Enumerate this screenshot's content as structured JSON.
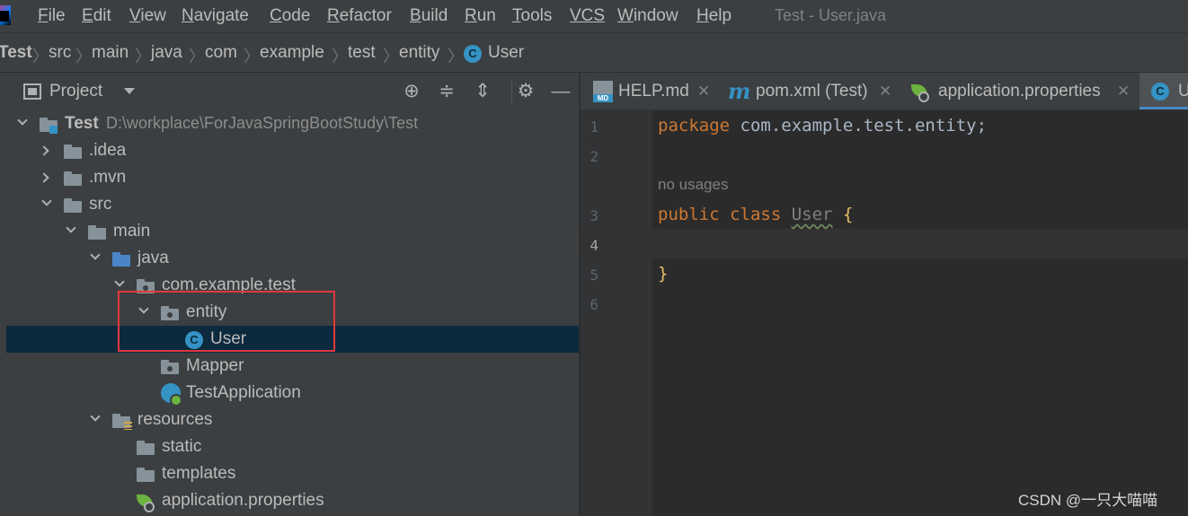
{
  "window": {
    "title": "Test - User.java"
  },
  "menu": {
    "items": [
      {
        "mnemonic": "F",
        "rest": "ile"
      },
      {
        "mnemonic": "E",
        "rest": "dit"
      },
      {
        "mnemonic": "V",
        "rest": "iew"
      },
      {
        "mnemonic": "N",
        "rest": "avigate"
      },
      {
        "mnemonic": "C",
        "rest": "ode"
      },
      {
        "mnemonic": "R",
        "rest": "efactor"
      },
      {
        "mnemonic": "B",
        "rest": "uild"
      },
      {
        "mnemonic": "R",
        "rest": "un"
      },
      {
        "mnemonic": "T",
        "rest": "ools"
      },
      {
        "mnemonic": "VCS",
        "rest": ""
      },
      {
        "mnemonic": "W",
        "rest": "indow"
      },
      {
        "mnemonic": "H",
        "rest": "elp"
      }
    ]
  },
  "breadcrumbs": [
    "Test",
    "src",
    "main",
    "java",
    "com",
    "example",
    "test",
    "entity",
    "User"
  ],
  "project_panel": {
    "title": "Project",
    "tree": {
      "root_label": "Test",
      "root_path": "D:\\workplace\\ForJavaSpringBootStudy\\Test",
      "idea": ".idea",
      "mvn": ".mvn",
      "src": "src",
      "main": "main",
      "java": "java",
      "package": "com.example.test",
      "entity": "entity",
      "user": "User",
      "mapper": "Mapper",
      "test_app": "TestApplication",
      "resources": "resources",
      "static": "static",
      "templates": "templates",
      "app_props": "application.properties"
    }
  },
  "editor": {
    "tabs": [
      "HELP.md",
      "pom.xml (Test)",
      "application.properties",
      "User"
    ],
    "active_tab": "User",
    "line_numbers": [
      "1",
      "2",
      "3",
      "4",
      "5",
      "6"
    ],
    "code": {
      "line1_kw": "package",
      "line1_rest": " com.example.test.entity;",
      "usage_hint": "no usages",
      "line3_kw": "public class",
      "line3_name": "User",
      "line3_brace": "{",
      "line5_brace": "}"
    },
    "current_line": "4"
  },
  "watermark": "CSDN @一只大喵喵",
  "colors": {
    "accent": "#4a88c7",
    "selection": "#0d293e",
    "highlight_box": "#e0393c",
    "keyword": "#cc7832"
  }
}
